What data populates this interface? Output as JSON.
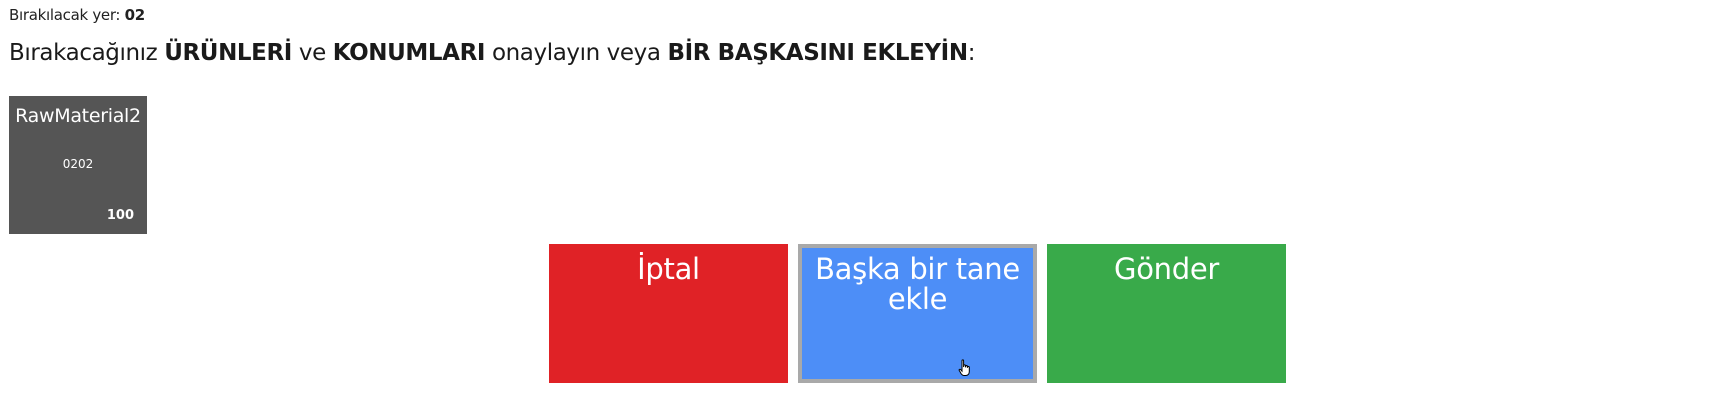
{
  "drop_location": {
    "label": "Bırakılacak yer: ",
    "value": "02"
  },
  "instruction": {
    "part1": "Bırakacağınız ",
    "bold1": "ÜRÜNLERİ",
    "part2": " ve ",
    "bold2": "KONUMLARI",
    "part3": " onaylayın veya ",
    "bold3": "BİR BAŞKASINI EKLEYİN",
    "part4": ":"
  },
  "products": [
    {
      "name": "RawMaterial2",
      "code": "0202",
      "quantity": "100",
      "color": "#555555"
    }
  ],
  "actions": {
    "cancel_label": "İptal",
    "add_another_label": "Başka bir tane ekle",
    "send_label": "Gönder"
  },
  "colors": {
    "cancel": "#e02226",
    "add_another": "#4d8ef7",
    "send": "#39aa4a",
    "selected_border": "#a9a9a9"
  },
  "icons": {
    "cursor": "hand-pointer-icon"
  }
}
